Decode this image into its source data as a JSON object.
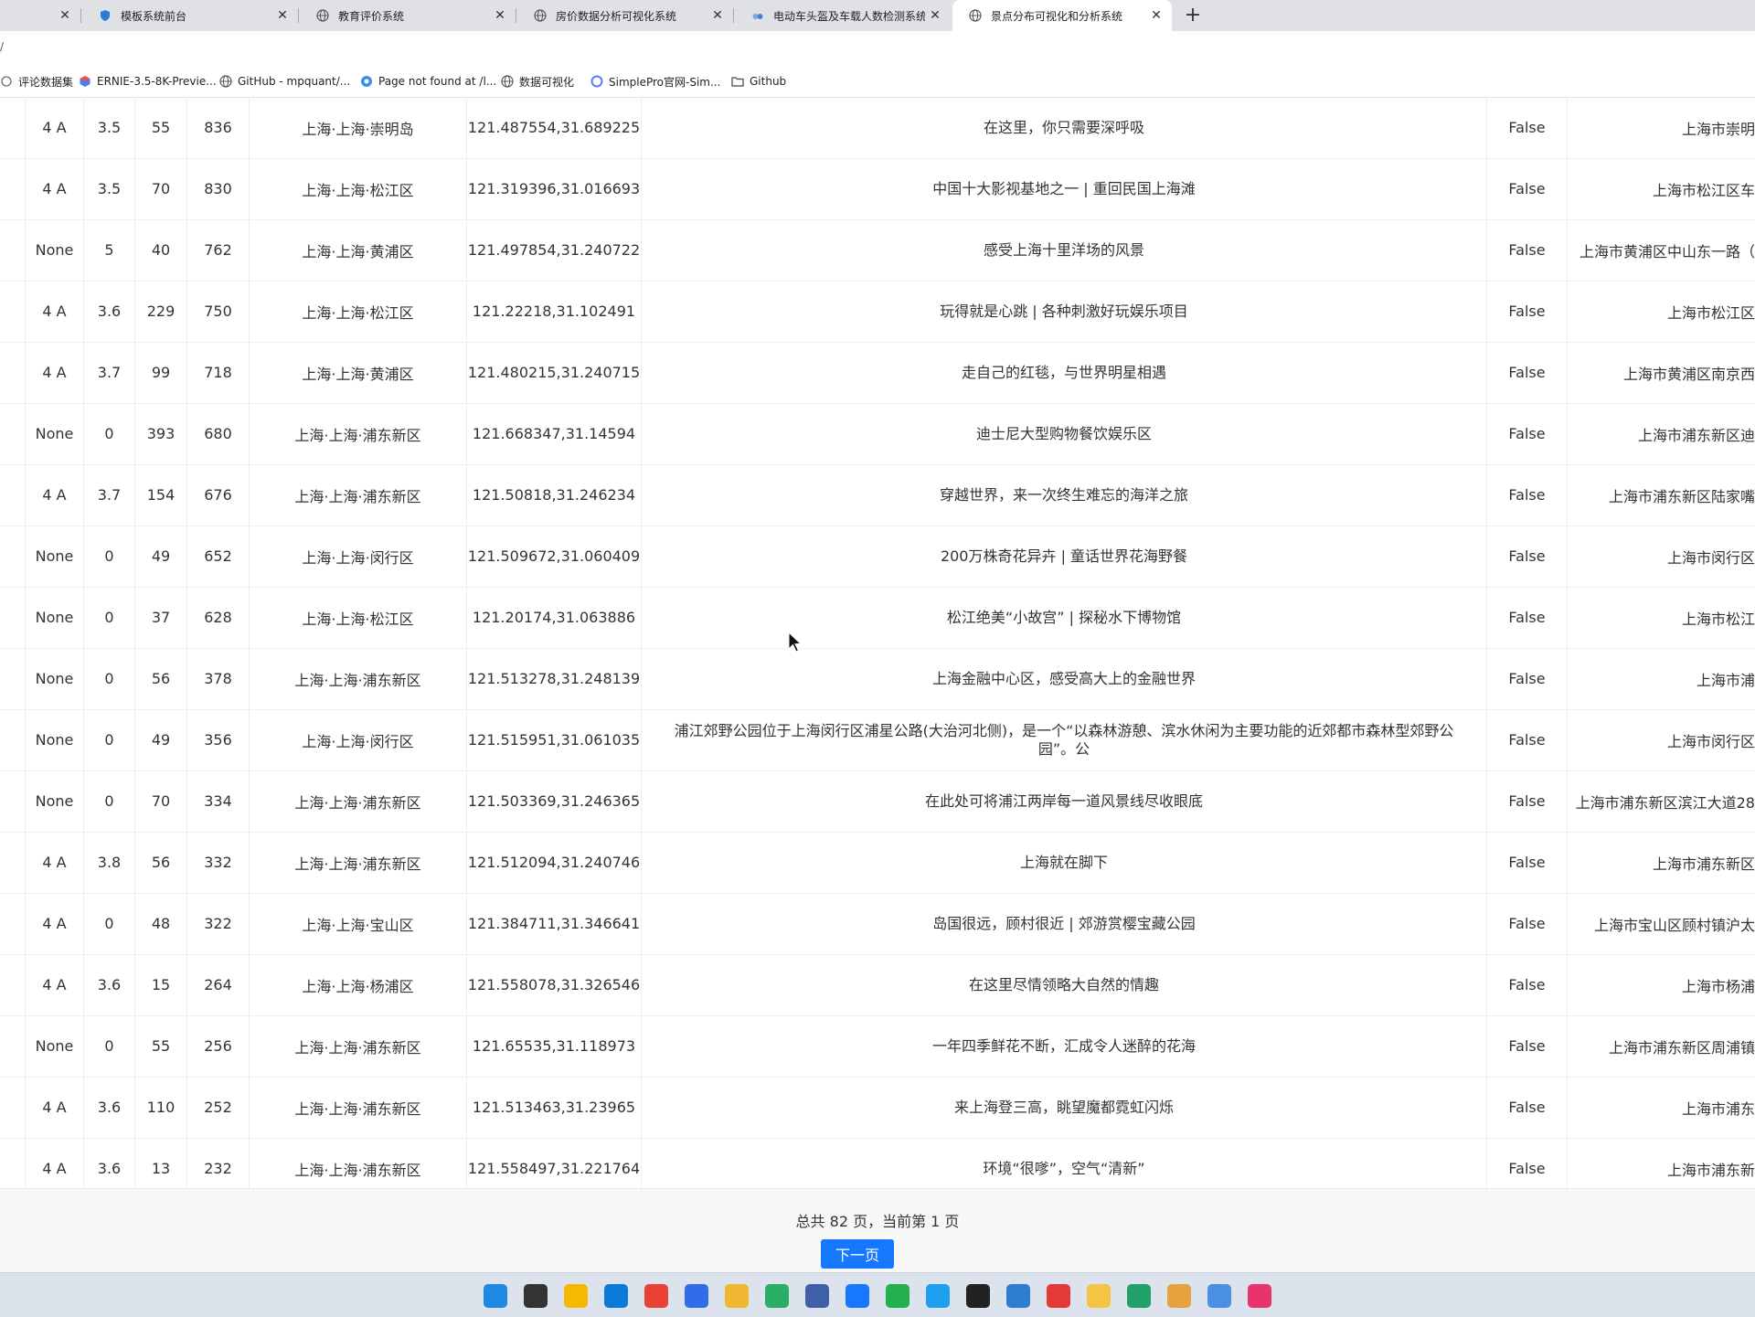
{
  "browser": {
    "tabs": [
      {
        "label": "",
        "icon": "page-icon",
        "active": false
      },
      {
        "label": "模板系统前台",
        "icon": "shield-icon",
        "active": false
      },
      {
        "label": "教育评价系统",
        "icon": "globe-icon",
        "active": false
      },
      {
        "label": "房价数据分析可视化系统",
        "icon": "globe-icon",
        "active": false
      },
      {
        "label": "电动车头盔及车载人数检测系统",
        "icon": "app-icon",
        "active": false
      },
      {
        "label": "景点分布可视化和分析系统",
        "icon": "globe-icon",
        "active": true
      }
    ],
    "address_fragment": "/",
    "bookmarks": [
      {
        "label": "评论数据集",
        "icon": "globe-icon"
      },
      {
        "label": "ERNIE-3.5-8K-Previe...",
        "icon": "ernie-icon"
      },
      {
        "label": "GitHub - mpquant/...",
        "icon": "globe-icon"
      },
      {
        "label": "Page not found at /l...",
        "icon": "django-icon"
      },
      {
        "label": "数据可视化",
        "icon": "globe-icon"
      },
      {
        "label": "SimplePro官网-Sim...",
        "icon": "simplepro-icon"
      },
      {
        "label": "Github",
        "icon": "folder-icon"
      }
    ]
  },
  "table": {
    "rows": [
      {
        "level": "4 A",
        "score": "3.5",
        "comments": "55",
        "sales": "836",
        "region": "上海·上海·崇明岛",
        "coords": "121.487554,31.689225",
        "desc": "在这里，你只需要深呼吸",
        "flag": "False",
        "address": "上海市崇明"
      },
      {
        "level": "4 A",
        "score": "3.5",
        "comments": "70",
        "sales": "830",
        "region": "上海·上海·松江区",
        "coords": "121.319396,31.016693",
        "desc": "中国十大影视基地之一 | 重回民国上海滩",
        "flag": "False",
        "address": "上海市松江区车"
      },
      {
        "level": "None",
        "score": "5",
        "comments": "40",
        "sales": "762",
        "region": "上海·上海·黄浦区",
        "coords": "121.497854,31.240722",
        "desc": "感受上海十里洋场的风景",
        "flag": "False",
        "address": "上海市黄浦区中山东一路（"
      },
      {
        "level": "4 A",
        "score": "3.6",
        "comments": "229",
        "sales": "750",
        "region": "上海·上海·松江区",
        "coords": "121.22218,31.102491",
        "desc": "玩得就是心跳 | 各种刺激好玩娱乐项目",
        "flag": "False",
        "address": "上海市松江区"
      },
      {
        "level": "4 A",
        "score": "3.7",
        "comments": "99",
        "sales": "718",
        "region": "上海·上海·黄浦区",
        "coords": "121.480215,31.240715",
        "desc": "走自己的红毯，与世界明星相遇",
        "flag": "False",
        "address": "上海市黄浦区南京西"
      },
      {
        "level": "None",
        "score": "0",
        "comments": "393",
        "sales": "680",
        "region": "上海·上海·浦东新区",
        "coords": "121.668347,31.14594",
        "desc": "迪士尼大型购物餐饮娱乐区",
        "flag": "False",
        "address": "上海市浦东新区迪"
      },
      {
        "level": "4 A",
        "score": "3.7",
        "comments": "154",
        "sales": "676",
        "region": "上海·上海·浦东新区",
        "coords": "121.50818,31.246234",
        "desc": "穿越世界，来一次终生难忘的海洋之旅",
        "flag": "False",
        "address": "上海市浦东新区陆家嘴"
      },
      {
        "level": "None",
        "score": "0",
        "comments": "49",
        "sales": "652",
        "region": "上海·上海·闵行区",
        "coords": "121.509672,31.060409",
        "desc": "200万株奇花异卉 | 童话世界花海野餐",
        "flag": "False",
        "address": "上海市闵行区"
      },
      {
        "level": "None",
        "score": "0",
        "comments": "37",
        "sales": "628",
        "region": "上海·上海·松江区",
        "coords": "121.20174,31.063886",
        "desc": "松江绝美“小故宫” | 探秘水下博物馆",
        "flag": "False",
        "address": "上海市松江"
      },
      {
        "level": "None",
        "score": "0",
        "comments": "56",
        "sales": "378",
        "region": "上海·上海·浦东新区",
        "coords": "121.513278,31.248139",
        "desc": "上海金融中心区，感受高大上的金融世界",
        "flag": "False",
        "address": "上海市浦"
      },
      {
        "level": "None",
        "score": "0",
        "comments": "49",
        "sales": "356",
        "region": "上海·上海·闵行区",
        "coords": "121.515951,31.061035",
        "desc": "浦江郊野公园位于上海闵行区浦星公路(大治河北侧)，是一个“以森林游憩、滨水休闲为主要功能的近郊都市森林型郊野公园”。公",
        "flag": "False",
        "address": "上海市闵行区"
      },
      {
        "level": "None",
        "score": "0",
        "comments": "70",
        "sales": "334",
        "region": "上海·上海·浦东新区",
        "coords": "121.503369,31.246365",
        "desc": "在此处可将浦江两岸每一道风景线尽收眼底",
        "flag": "False",
        "address": "上海市浦东新区滨江大道28"
      },
      {
        "level": "4 A",
        "score": "3.8",
        "comments": "56",
        "sales": "332",
        "region": "上海·上海·浦东新区",
        "coords": "121.512094,31.240746",
        "desc": "上海就在脚下",
        "flag": "False",
        "address": "上海市浦东新区"
      },
      {
        "level": "4 A",
        "score": "0",
        "comments": "48",
        "sales": "322",
        "region": "上海·上海·宝山区",
        "coords": "121.384711,31.346641",
        "desc": "岛国很远，顾村很近 | 郊游赏樱宝藏公园",
        "flag": "False",
        "address": "上海市宝山区顾村镇沪太"
      },
      {
        "level": "4 A",
        "score": "3.6",
        "comments": "15",
        "sales": "264",
        "region": "上海·上海·杨浦区",
        "coords": "121.558078,31.326546",
        "desc": "在这里尽情领略大自然的情趣",
        "flag": "False",
        "address": "上海市杨浦"
      },
      {
        "level": "None",
        "score": "0",
        "comments": "55",
        "sales": "256",
        "region": "上海·上海·浦东新区",
        "coords": "121.65535,31.118973",
        "desc": "一年四季鲜花不断，汇成令人迷醉的花海",
        "flag": "False",
        "address": "上海市浦东新区周浦镇"
      },
      {
        "level": "4 A",
        "score": "3.6",
        "comments": "110",
        "sales": "252",
        "region": "上海·上海·浦东新区",
        "coords": "121.513463,31.23965",
        "desc": "来上海登三高，眺望魔都霓虹闪烁",
        "flag": "False",
        "address": "上海市浦东"
      },
      {
        "level": "4 A",
        "score": "3.6",
        "comments": "13",
        "sales": "232",
        "region": "上海·上海·浦东新区",
        "coords": "121.558497,31.221764",
        "desc": "环境“很嗲”，空气“清新”",
        "flag": "False",
        "address": "上海市浦东新"
      }
    ]
  },
  "pagination": {
    "info": "总共 82 页，当前第 1 页",
    "next_label": "下一页"
  },
  "taskbar": {
    "icons": [
      {
        "name": "windows-start-icon",
        "color": "#1e88e5"
      },
      {
        "name": "task-view-icon",
        "color": "#333333"
      },
      {
        "name": "security-app-icon",
        "color": "#f6b800"
      },
      {
        "name": "edge-browser-icon",
        "color": "#0c7bd8"
      },
      {
        "name": "chrome-browser-icon",
        "color": "#e94235"
      },
      {
        "name": "app-circle-icon",
        "color": "#2f6ee8"
      },
      {
        "name": "file-explorer-icon",
        "color": "#f2b632"
      },
      {
        "name": "wechat-icon",
        "color": "#2aae67"
      },
      {
        "name": "remote-desktop-icon",
        "color": "#3f5fa8"
      },
      {
        "name": "feishu-icon",
        "color": "#1677ff"
      },
      {
        "name": "pycharm-icon",
        "color": "#22b14c"
      },
      {
        "name": "chat-bubble-icon",
        "color": "#1ea0f0"
      },
      {
        "name": "qq-icon",
        "color": "#222222"
      },
      {
        "name": "photos-icon",
        "color": "#2d7dd2"
      },
      {
        "name": "battery-app-icon",
        "color": "#e53935"
      },
      {
        "name": "paint-icon",
        "color": "#f4c542"
      },
      {
        "name": "green-app-icon",
        "color": "#22a06b"
      },
      {
        "name": "notes-app-icon",
        "color": "#e6a23c"
      },
      {
        "name": "flower-app-icon",
        "color": "#4a90e2"
      },
      {
        "name": "pink-app-icon",
        "color": "#e8336d"
      }
    ]
  }
}
